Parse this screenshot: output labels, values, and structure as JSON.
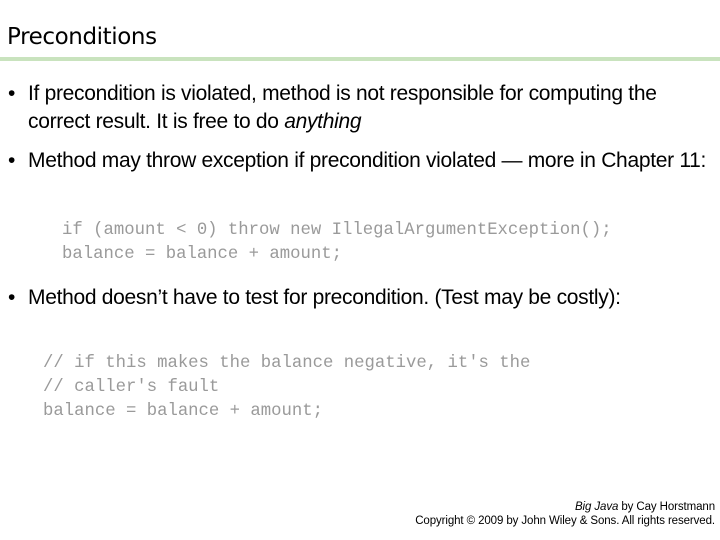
{
  "slide": {
    "title": "Preconditions",
    "bullets": [
      {
        "text": "If precondition is violated, method is not responsible for computing the correct result. It is free to do ",
        "emphasis": "anything"
      },
      {
        "text": "Method may throw exception if precondition violated — more in Chapter 11:",
        "code": [
          "if (amount < 0) throw new IllegalArgumentException();",
          "balance = balance + amount;"
        ]
      },
      {
        "text": "Method doesn’t have to test for precondition. (Test may be costly):",
        "code": [
          "// if this makes the balance negative, it's the",
          "// caller's fault",
          "balance = balance + amount;"
        ]
      }
    ],
    "bullet_glyph": "•",
    "accent_color": "#c9e3be",
    "code_color": "#9a9a9a"
  },
  "footer": {
    "book_title": "Big Java",
    "author_line": " by Cay Horstmann",
    "copyright": "Copyright © 2009 by John Wiley & Sons.  All rights reserved."
  }
}
